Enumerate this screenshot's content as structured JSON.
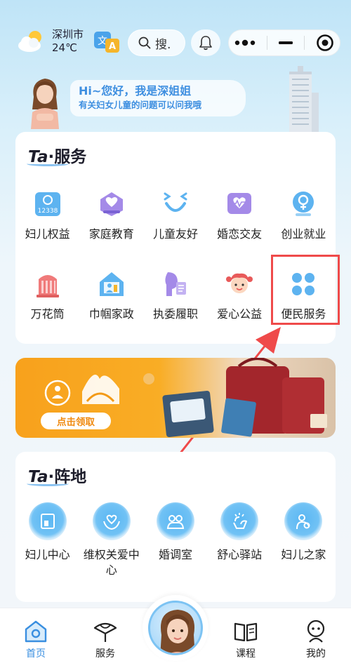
{
  "header": {
    "city": "深圳市",
    "temperature": "24℃",
    "search_label": "搜."
  },
  "greeting": {
    "line1": "Hi~您好，我是深姐姐",
    "line2": "有关妇女儿童的问题可以问我哦"
  },
  "services": {
    "title_prefix": "Ta",
    "title_text": "·服务",
    "items": [
      {
        "label": "妇儿权益",
        "icon": "rights-icon"
      },
      {
        "label": "家庭教育",
        "icon": "family-education-icon"
      },
      {
        "label": "儿童友好",
        "icon": "child-friendly-icon"
      },
      {
        "label": "婚恋交友",
        "icon": "dating-icon"
      },
      {
        "label": "创业就业",
        "icon": "employment-icon"
      },
      {
        "label": "万花筒",
        "icon": "kaleidoscope-icon"
      },
      {
        "label": "巾帼家政",
        "icon": "housekeeping-icon"
      },
      {
        "label": "执委履职",
        "icon": "duty-icon"
      },
      {
        "label": "爱心公益",
        "icon": "charity-icon"
      },
      {
        "label": "便民服务",
        "icon": "convenience-icon"
      }
    ]
  },
  "banner": {
    "cta": "点击领取"
  },
  "positions": {
    "title_prefix": "Ta",
    "title_text": "·阵地",
    "items": [
      {
        "label": "妇儿中心",
        "icon": "center-icon"
      },
      {
        "label": "维权关爱中心",
        "icon": "care-icon"
      },
      {
        "label": "婚调室",
        "icon": "mediation-icon"
      },
      {
        "label": "舒心驿站",
        "icon": "relax-icon"
      },
      {
        "label": "妇儿之家",
        "icon": "home-icon"
      }
    ]
  },
  "tabbar": {
    "items": [
      {
        "label": "首页",
        "icon": "home-tab-icon"
      },
      {
        "label": "服务",
        "icon": "service-tab-icon"
      },
      {
        "label": "课程",
        "icon": "course-tab-icon"
      },
      {
        "label": "我的",
        "icon": "profile-tab-icon"
      }
    ]
  },
  "colors": {
    "accent": "#3a8fe0",
    "highlight": "#ef4a4a",
    "banner": "#f8a11c"
  }
}
